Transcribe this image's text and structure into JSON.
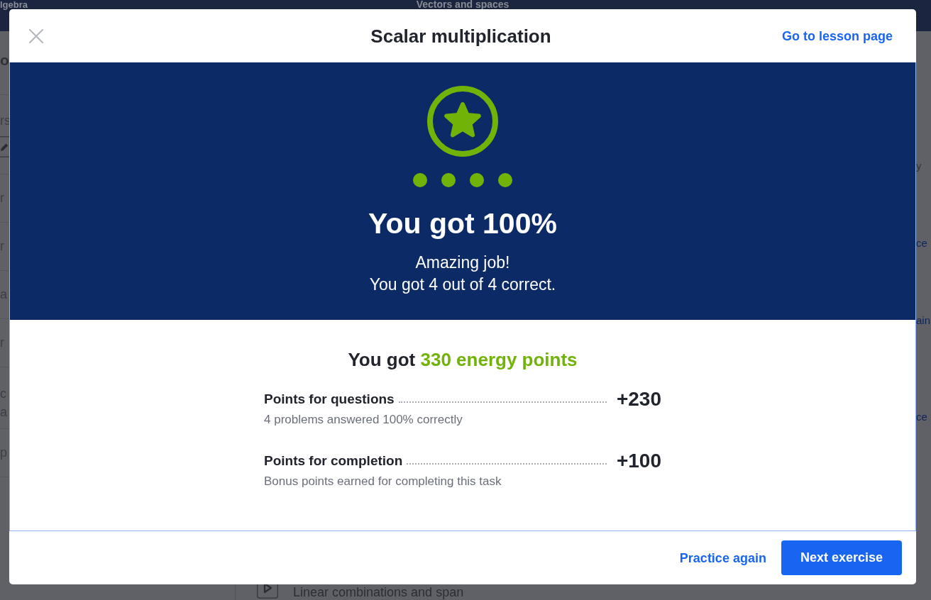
{
  "background_page": {
    "header": {
      "course": "lgebra",
      "unit": "Vectors and spaces"
    },
    "sidebar_rows": [
      {
        "kind": "heading",
        "lines": [
          "o"
        ]
      },
      {
        "kind": "label",
        "lines": [
          "rs"
        ]
      },
      {
        "kind": "icon"
      },
      {
        "kind": "item",
        "lines": [
          "r"
        ]
      },
      {
        "kind": "item",
        "lines": [
          "r"
        ]
      },
      {
        "kind": "item",
        "lines": [
          "a"
        ]
      },
      {
        "kind": "item",
        "lines": [
          "r"
        ]
      },
      {
        "kind": "item",
        "lines": [
          "c",
          "a"
        ]
      },
      {
        "kind": "item",
        "lines": [
          "p"
        ]
      }
    ],
    "right_edge": [
      {
        "kind": "text",
        "text": "y"
      },
      {
        "kind": "link",
        "text": "ce"
      },
      {
        "kind": "link",
        "text": "ain"
      },
      {
        "kind": "link",
        "text": "ce"
      }
    ],
    "lesson_row": {
      "title": "Linear combinations and span"
    }
  },
  "dialog": {
    "title": "Scalar multiplication",
    "lesson_link": "Go to lesson page",
    "banner": {
      "question_results": [
        {
          "correct": true
        },
        {
          "correct": true
        },
        {
          "correct": true
        },
        {
          "correct": true
        }
      ],
      "score_title": "You got 100%",
      "messages": [
        "Amazing job!",
        "You got 4 out of 4 correct."
      ]
    },
    "energy_points": {
      "prefix": "You got",
      "amount": "330 energy points",
      "items": [
        {
          "label": "Points for questions",
          "points": "+230",
          "detail": "4 problems answered 100% correctly"
        },
        {
          "label": "Points for completion",
          "points": "+100",
          "detail": "Bonus points earned for completing this task"
        }
      ]
    },
    "buttons": [
      {
        "kind": "link",
        "label": "Practice again"
      },
      {
        "kind": "primary",
        "label": "Next exercise"
      }
    ]
  }
}
